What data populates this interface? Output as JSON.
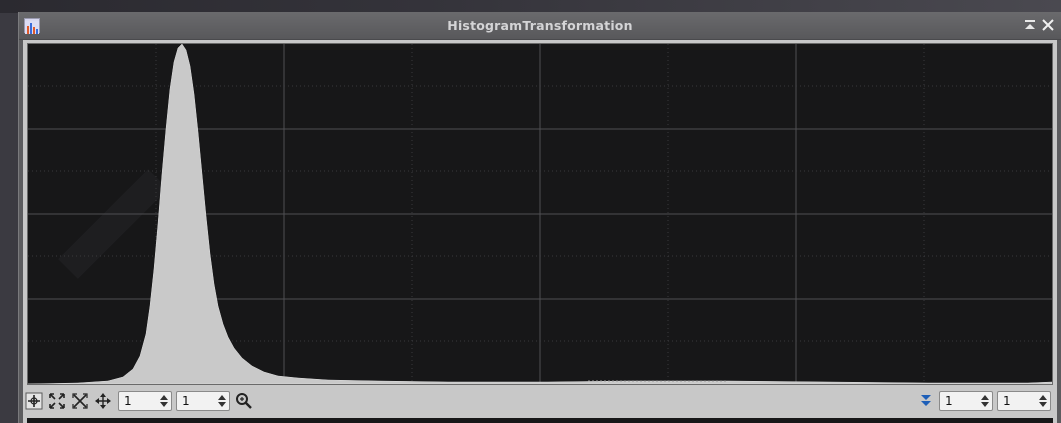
{
  "window": {
    "title": "HistogramTransformation",
    "icons": [
      "app-histogram-icon",
      "shade-icon",
      "close-icon"
    ]
  },
  "histogram": {
    "background_color": "#171718",
    "grid_color": "#555555",
    "fill_color": "#c8c8c8",
    "peak_position_fraction": 0.15,
    "channel": "combined"
  },
  "toolbar": {
    "left_icons": [
      "edit-mode-icon",
      "zoom-fit-icon",
      "zoom-reset-icon",
      "scroll-mode-icon",
      "zoom-icon"
    ],
    "horizontal_zoom": "1",
    "vertical_zoom": "1",
    "right_icon": "expand-down-icon",
    "right_zoom_1": "1",
    "right_zoom_2": "1"
  }
}
